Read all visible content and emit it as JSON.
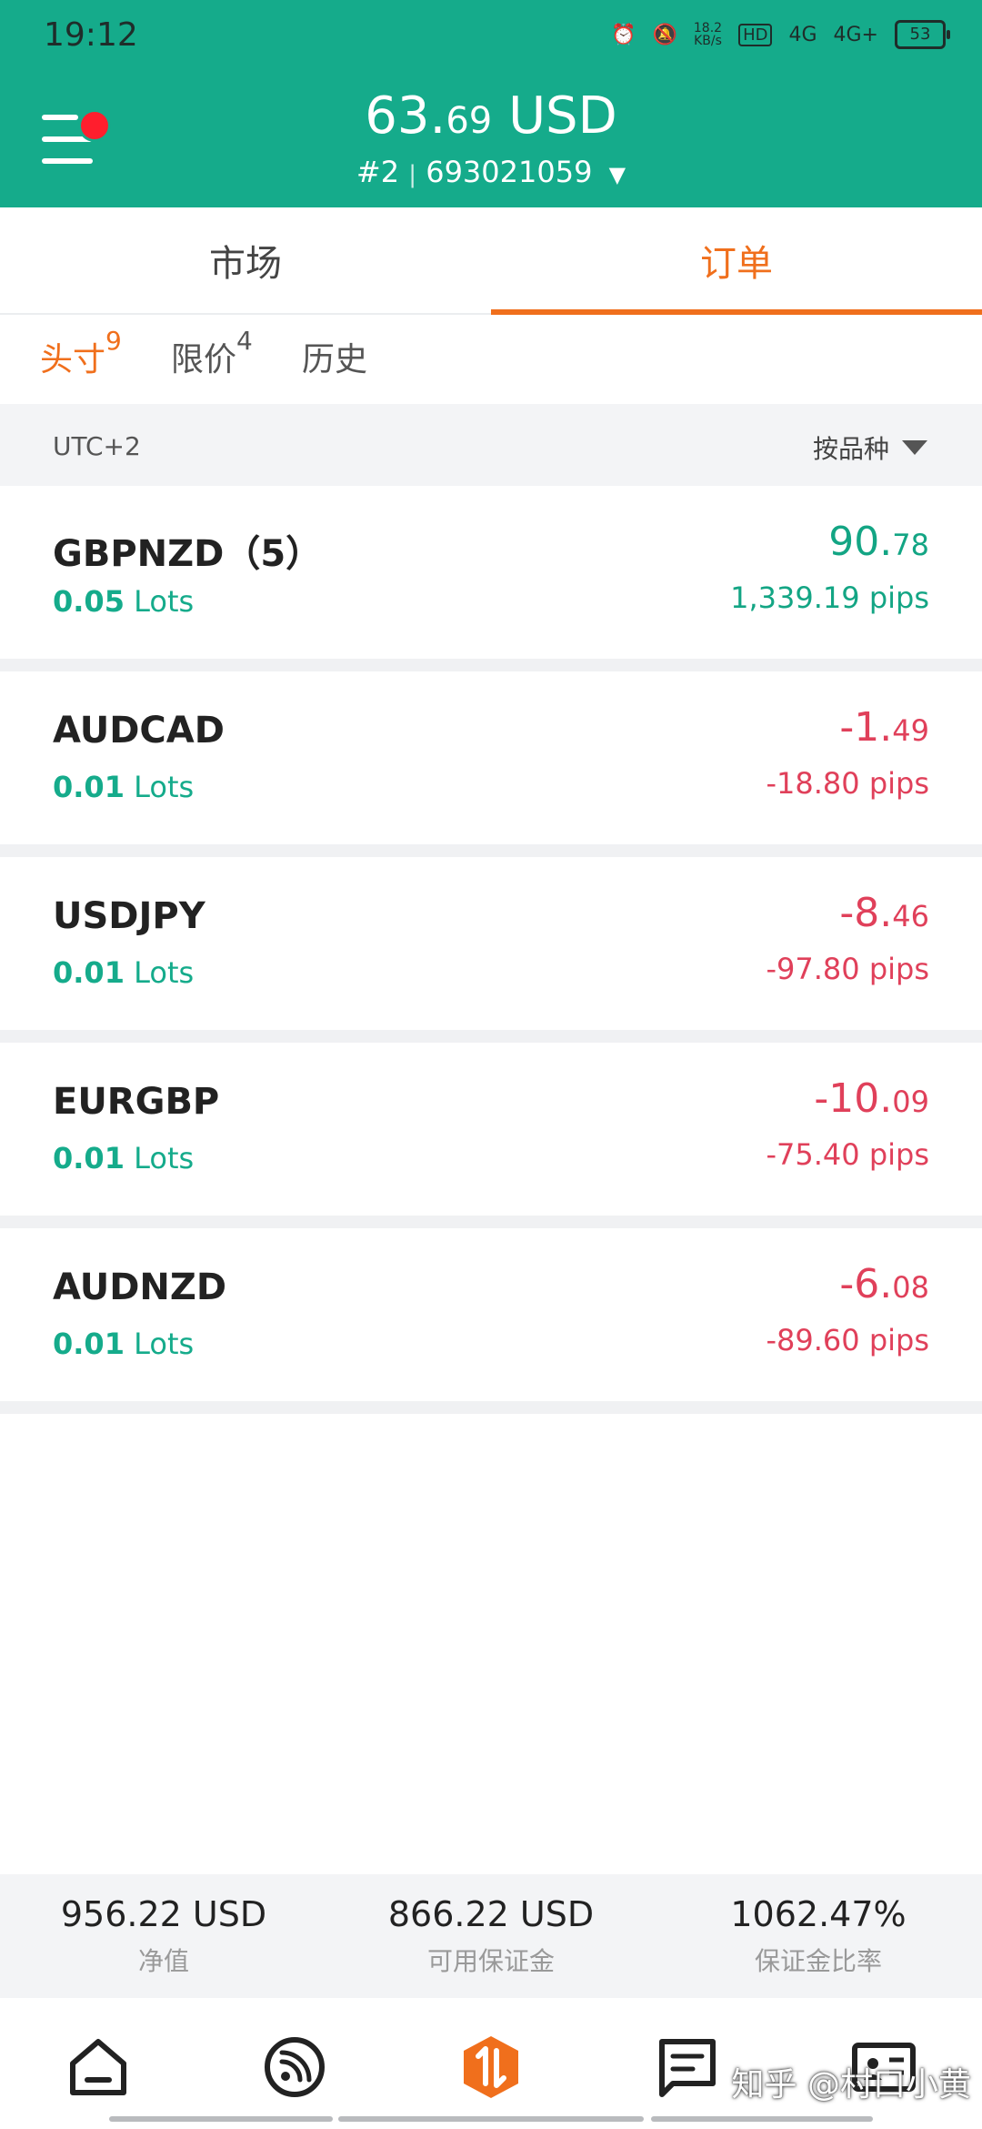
{
  "status_bar": {
    "time": "19:12",
    "net_speed_top": "18.2",
    "net_speed_unit": "KB/s",
    "hd": "HD",
    "sig1": "4G",
    "sig2": "4G+",
    "battery": "53"
  },
  "header": {
    "balance_int": "63.",
    "balance_dec": "69",
    "currency": "USD",
    "account_prefix": "#2",
    "account_number": "693021059",
    "bg_color": "#15ab8b"
  },
  "tabs": [
    {
      "label": "市场",
      "active": false
    },
    {
      "label": "订单",
      "active": true
    }
  ],
  "subtabs": [
    {
      "label": "头寸",
      "count": "9",
      "active": true
    },
    {
      "label": "限价",
      "count": "4",
      "active": false
    },
    {
      "label": "历史",
      "count": "",
      "active": false
    }
  ],
  "filter": {
    "timezone": "UTC+2",
    "sort_label": "按品种"
  },
  "orders": [
    {
      "symbol": "GBPNZD（5）",
      "lots_value": "0.05",
      "lots_unit": "Lots",
      "pnl_int": "90.",
      "pnl_dec": "78",
      "pips": "1,339.19 pips",
      "positive": true
    },
    {
      "symbol": "AUDCAD",
      "lots_value": "0.01",
      "lots_unit": "Lots",
      "pnl_int": "-1.",
      "pnl_dec": "49",
      "pips": "-18.80 pips",
      "positive": false
    },
    {
      "symbol": "USDJPY",
      "lots_value": "0.01",
      "lots_unit": "Lots",
      "pnl_int": "-8.",
      "pnl_dec": "46",
      "pips": "-97.80 pips",
      "positive": false
    },
    {
      "symbol": "EURGBP",
      "lots_value": "0.01",
      "lots_unit": "Lots",
      "pnl_int": "-10.",
      "pnl_dec": "09",
      "pips": "-75.40 pips",
      "positive": false
    },
    {
      "symbol": "AUDNZD",
      "lots_value": "0.01",
      "lots_unit": "Lots",
      "pnl_int": "-6.",
      "pnl_dec": "08",
      "pips": "-89.60 pips",
      "positive": false
    }
  ],
  "summary": [
    {
      "value": "956.22 USD",
      "label": "净值"
    },
    {
      "value": "866.22 USD",
      "label": "可用保证金"
    },
    {
      "value": "1062.47%",
      "label": "保证金比率"
    }
  ],
  "bottom_nav": {
    "icons": [
      "home-icon",
      "signal-icon",
      "trade-icon",
      "news-icon",
      "profile-card-icon"
    ],
    "watermark": "知乎 @村口小黄"
  },
  "colors": {
    "accent": "#f06f1c",
    "positive": "#13a584",
    "negative": "#e0405a"
  }
}
